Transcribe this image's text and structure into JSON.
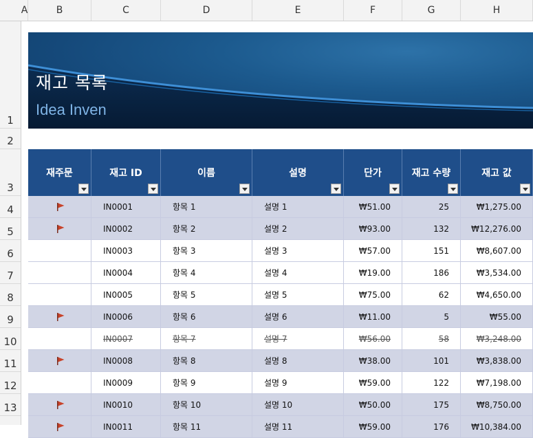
{
  "columns": [
    "A",
    "B",
    "C",
    "D",
    "E",
    "F",
    "G",
    "H"
  ],
  "rows": [
    "1",
    "2",
    "3",
    "4",
    "5",
    "6",
    "7",
    "8",
    "9",
    "10",
    "11",
    "12",
    "13"
  ],
  "banner": {
    "title": "재고 목록",
    "subtitle": "Idea Inven"
  },
  "table": {
    "headers": [
      "재주문",
      "재고 ID",
      "이름",
      "설명",
      "단가",
      "재고 수량",
      "재고 값"
    ],
    "items": [
      {
        "reorder": true,
        "id": "IN0001",
        "name": "항목 1",
        "desc": "설명 1",
        "price": "₩51.00",
        "qty": "25",
        "value": "₩1,275.00",
        "discontinued": false
      },
      {
        "reorder": true,
        "id": "IN0002",
        "name": "항목 2",
        "desc": "설명 2",
        "price": "₩93.00",
        "qty": "132",
        "value": "₩12,276.00",
        "discontinued": false
      },
      {
        "reorder": false,
        "id": "IN0003",
        "name": "항목 3",
        "desc": "설명 3",
        "price": "₩57.00",
        "qty": "151",
        "value": "₩8,607.00",
        "discontinued": false
      },
      {
        "reorder": false,
        "id": "IN0004",
        "name": "항목 4",
        "desc": "설명 4",
        "price": "₩19.00",
        "qty": "186",
        "value": "₩3,534.00",
        "discontinued": false
      },
      {
        "reorder": false,
        "id": "IN0005",
        "name": "항목 5",
        "desc": "설명 5",
        "price": "₩75.00",
        "qty": "62",
        "value": "₩4,650.00",
        "discontinued": false
      },
      {
        "reorder": true,
        "id": "IN0006",
        "name": "항목 6",
        "desc": "설명 6",
        "price": "₩11.00",
        "qty": "5",
        "value": "₩55.00",
        "discontinued": false
      },
      {
        "reorder": false,
        "id": "IN0007",
        "name": "항목 7",
        "desc": "설명 7",
        "price": "₩56.00",
        "qty": "58",
        "value": "₩3,248.00",
        "discontinued": true
      },
      {
        "reorder": true,
        "id": "IN0008",
        "name": "항목 8",
        "desc": "설명 8",
        "price": "₩38.00",
        "qty": "101",
        "value": "₩3,838.00",
        "discontinued": false
      },
      {
        "reorder": false,
        "id": "IN0009",
        "name": "항목 9",
        "desc": "설명 9",
        "price": "₩59.00",
        "qty": "122",
        "value": "₩7,198.00",
        "discontinued": false
      },
      {
        "reorder": true,
        "id": "IN0010",
        "name": "항목 10",
        "desc": "설명 10",
        "price": "₩50.00",
        "qty": "175",
        "value": "₩8,750.00",
        "discontinued": false
      },
      {
        "reorder": true,
        "id": "IN0011",
        "name": "항목 11",
        "desc": "설명 11",
        "price": "₩59.00",
        "qty": "176",
        "value": "₩10,384.00",
        "discontinued": false
      }
    ]
  },
  "colors": {
    "header_bg": "#1f4e8a",
    "flag_row_bg": "#d1d5e5",
    "flag": "#c8432a",
    "subtitle": "#7fb4e6"
  },
  "icons": {
    "reorder": "flag-icon",
    "filter": "filter-dropdown-icon"
  }
}
